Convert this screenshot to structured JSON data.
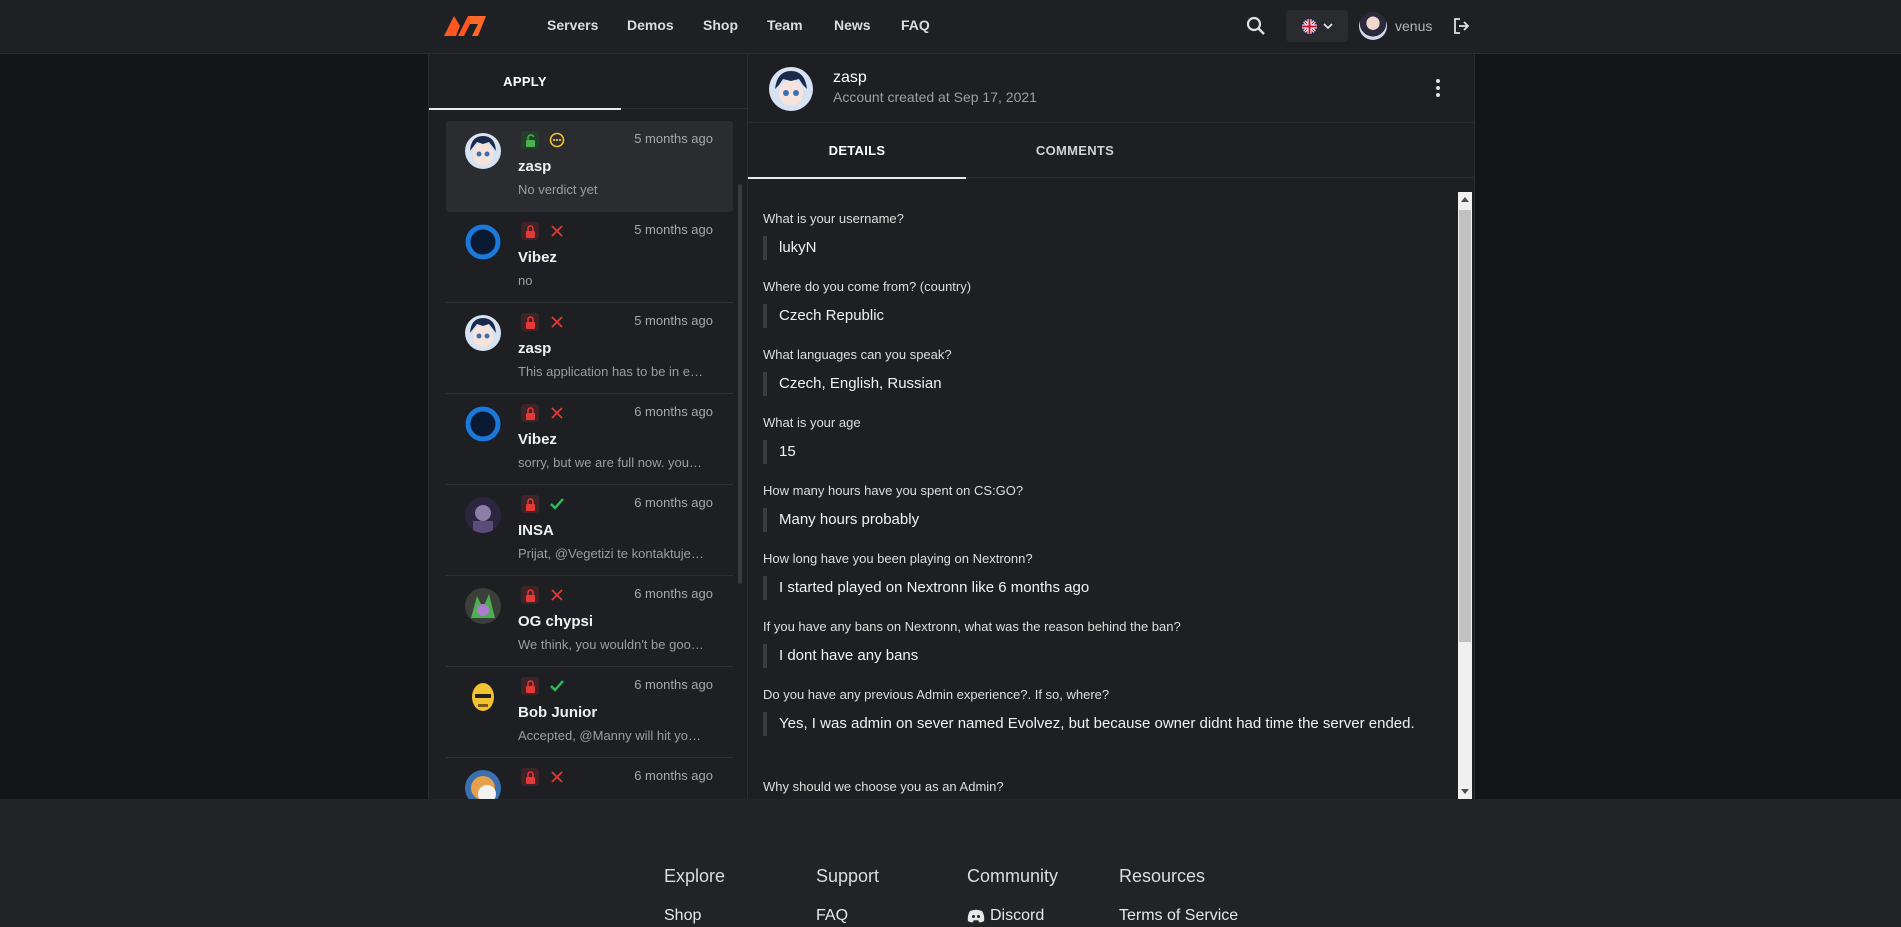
{
  "nav": {
    "links": [
      "Servers",
      "Demos",
      "Shop",
      "Team",
      "News",
      "FAQ"
    ],
    "username": "venus",
    "accent": "#ff5722"
  },
  "left": {
    "tab_label": "APPLY",
    "items": [
      {
        "name": "zasp",
        "time": "5 months ago",
        "message": "No verdict yet",
        "lock": "open",
        "verdict": "pending",
        "avatar": "anime"
      },
      {
        "name": "Vibez",
        "time": "5 months ago",
        "message": "no",
        "lock": "closed",
        "verdict": "rejected",
        "avatar": "blue"
      },
      {
        "name": "zasp",
        "time": "5 months ago",
        "message": "This application has to be in e…",
        "lock": "closed",
        "verdict": "rejected",
        "avatar": "anime"
      },
      {
        "name": "Vibez",
        "time": "6 months ago",
        "message": "sorry, but we are full now. you…",
        "lock": "closed",
        "verdict": "rejected",
        "avatar": "blue"
      },
      {
        "name": "INSA",
        "time": "6 months ago",
        "message": "Prijat, @Vegetizi te kontaktuje…",
        "lock": "closed",
        "verdict": "accepted",
        "avatar": "dark"
      },
      {
        "name": "OG chypsi",
        "time": "6 months ago",
        "message": "We think, you wouldn't be goo…",
        "lock": "closed",
        "verdict": "rejected",
        "avatar": "green"
      },
      {
        "name": "Bob Junior",
        "time": "6 months ago",
        "message": "Accepted, @Manny will hit yo…",
        "lock": "closed",
        "verdict": "accepted",
        "avatar": "yellow"
      },
      {
        "name": "",
        "time": "6 months ago",
        "message": "",
        "lock": "closed",
        "verdict": "rejected",
        "avatar": "orange"
      }
    ]
  },
  "profile": {
    "name": "zasp",
    "created": "Account created at Sep 17, 2021",
    "tabs": [
      "DETAILS",
      "COMMENTS"
    ]
  },
  "qa": [
    {
      "q": "What is your username?",
      "a": "lukyN"
    },
    {
      "q": "Where do you come from? (country)",
      "a": "Czech Republic"
    },
    {
      "q": "What languages can you speak?",
      "a": "Czech, English, Russian"
    },
    {
      "q": "What is your age",
      "a": "15"
    },
    {
      "q": "How many hours have you spent on CS:GO?",
      "a": "Many hours probably"
    },
    {
      "q": "How long have you been playing on Nextronn?",
      "a": "I started played on Nextronn like 6 months ago"
    },
    {
      "q": "If you have any bans on Nextronn, what was the reason behind the ban?",
      "a": "I dont have any bans"
    },
    {
      "q": "Do you have any previous Admin experience?. If so, where?",
      "a": "Yes, I was admin on sever named Evolvez, but because owner didnt had time the server ended."
    },
    {
      "q": "Why should we choose you as an Admin?",
      "a": ""
    }
  ],
  "footer": {
    "columns": [
      {
        "head": "Explore",
        "link": "Shop"
      },
      {
        "head": "Support",
        "link": "FAQ"
      },
      {
        "head": "Community",
        "link": "Discord"
      },
      {
        "head": "Resources",
        "link": "Terms of Service"
      }
    ]
  }
}
